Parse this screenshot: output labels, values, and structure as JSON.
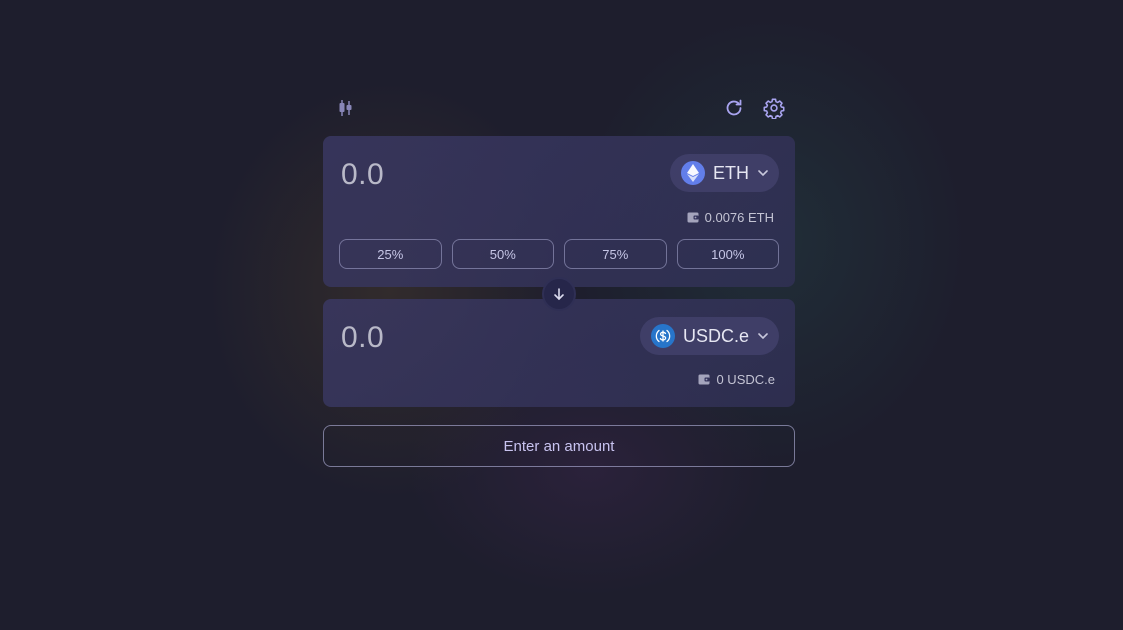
{
  "topbar": {
    "chart_icon": "candlestick-chart-icon",
    "refresh_icon": "refresh-icon",
    "settings_icon": "gear-icon"
  },
  "from": {
    "amount_placeholder": "0.0",
    "token": {
      "symbol": "ETH",
      "icon": "ethereum-logo"
    },
    "balance": "0.0076 ETH",
    "percent_buttons": [
      "25%",
      "50%",
      "75%",
      "100%"
    ]
  },
  "switch_icon": "arrow-down-icon",
  "to": {
    "amount_placeholder": "0.0",
    "token": {
      "symbol": "USDC.e",
      "icon": "usdc-logo"
    },
    "balance": "0 USDC.e"
  },
  "cta_label": "Enter an amount",
  "colors": {
    "background": "#1e1e2d",
    "panel": "#35345c",
    "accent": "#a9a4f0",
    "eth": "#627eea",
    "usdc": "#2775ca"
  }
}
